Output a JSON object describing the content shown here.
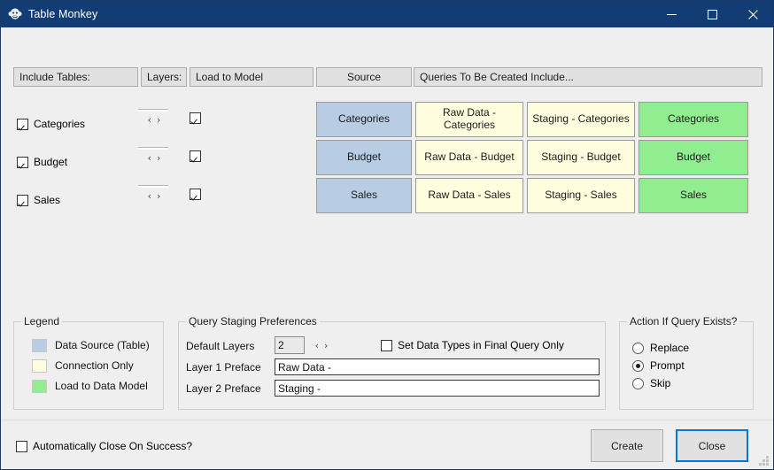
{
  "window": {
    "title": "Table Monkey",
    "icon": "monkey-icon",
    "minimize_label": "—",
    "maximize_label": "□",
    "close_label": "✕"
  },
  "colors": {
    "titlebar": "#123c74",
    "data_source": "#b8cce4",
    "connection_only": "#ffffe0",
    "load_to_model": "#90ee90",
    "accent_focus": "#0078d7",
    "panel": "#efefef"
  },
  "headers": {
    "include_tables": "Include Tables:",
    "layers": "Layers:",
    "load_to_model": "Load to Model",
    "source": "Source",
    "queries_to_be_created": "Queries To Be Created Include..."
  },
  "tables": [
    {
      "name": "Categories",
      "included": true,
      "load_to_model": true,
      "layers": ""
    },
    {
      "name": "Budget",
      "included": true,
      "load_to_model": true,
      "layers": ""
    },
    {
      "name": "Sales",
      "included": true,
      "load_to_model": true,
      "layers": ""
    }
  ],
  "queries": [
    {
      "source": "Categories",
      "layer1": "Raw Data - Categories",
      "layer2": "Staging - Categories",
      "final": "Categories"
    },
    {
      "source": "Budget",
      "layer1": "Raw Data - Budget",
      "layer2": "Staging - Budget",
      "final": "Budget"
    },
    {
      "source": "Sales",
      "layer1": "Raw Data - Sales",
      "layer2": "Staging - Sales",
      "final": "Sales"
    }
  ],
  "legend": {
    "caption": "Legend",
    "items": [
      {
        "label": "Data Source (Table)",
        "color": "#b8cce4"
      },
      {
        "label": "Connection Only",
        "color": "#ffffe0"
      },
      {
        "label": "Load to Data Model",
        "color": "#90ee90"
      }
    ]
  },
  "staging": {
    "caption": "Query Staging Preferences",
    "default_layers_label": "Default Layers",
    "default_layers_value": "2",
    "spinner_prev": "‹",
    "spinner_next": "›",
    "set_data_types_label": "Set Data Types in Final Query Only",
    "set_data_types_checked": false,
    "layer1_label": "Layer 1 Preface",
    "layer1_value": "Raw Data - ",
    "layer2_label": "Layer 2 Preface",
    "layer2_value": "Staging - "
  },
  "action_if_exists": {
    "caption": "Action If Query Exists?",
    "options": [
      {
        "label": "Replace",
        "selected": false
      },
      {
        "label": "Prompt",
        "selected": true
      },
      {
        "label": "Skip",
        "selected": false
      }
    ]
  },
  "footer": {
    "auto_close_label": "Automatically Close On Success?",
    "auto_close_checked": false,
    "create_label": "Create",
    "close_label": "Close"
  }
}
